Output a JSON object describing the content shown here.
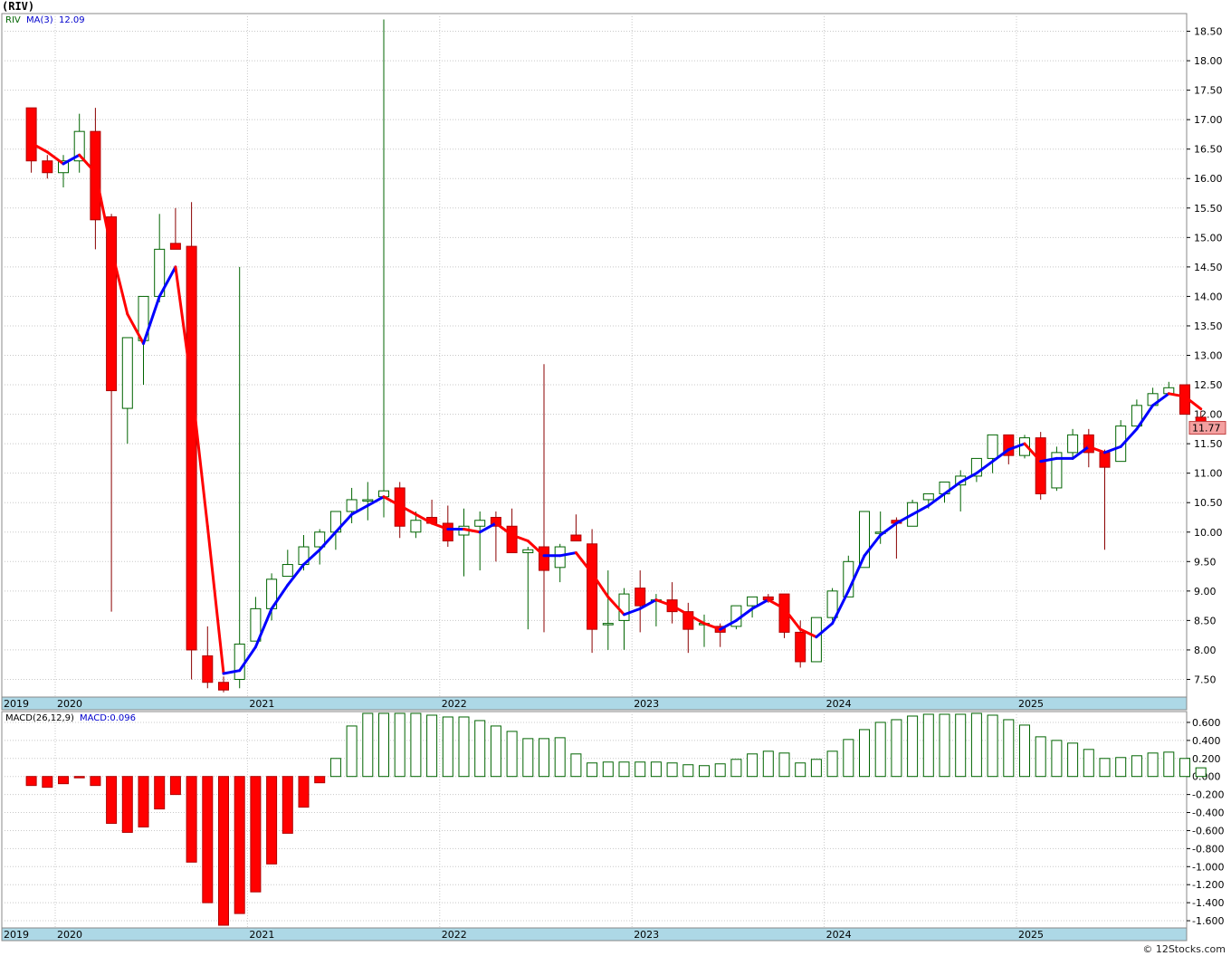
{
  "title": "(RIV)",
  "credit": "© 12Stocks.com",
  "price_panel": {
    "legend": {
      "symbol": "RIV",
      "ma_label": "MA(3)",
      "ma_value": "12.09"
    },
    "last_price": "11.77",
    "ylim": [
      7.2,
      18.8
    ],
    "y_ticks": [
      "7.50",
      "8.00",
      "8.50",
      "9.00",
      "9.50",
      "10.00",
      "10.50",
      "11.00",
      "11.50",
      "12.00",
      "12.50",
      "13.00",
      "13.50",
      "14.00",
      "14.50",
      "15.00",
      "15.50",
      "16.00",
      "16.50",
      "17.00",
      "17.50",
      "18.00",
      "18.50"
    ],
    "x_labels": [
      "2019",
      "2020",
      "2021",
      "2022",
      "2023",
      "2024",
      "2025"
    ]
  },
  "macd_panel": {
    "legend": {
      "label": "MACD(26,12,9)",
      "value": "MACD:0.096"
    },
    "ylim": [
      -1.68,
      0.72
    ],
    "y_ticks": [
      "-1.600",
      "-1.400",
      "-1.200",
      "-1.000",
      "-0.800",
      "-0.600",
      "-0.400",
      "-0.200",
      "0.000",
      "0.200",
      "0.400",
      "0.600"
    ],
    "x_labels": [
      "2019",
      "2020",
      "2021",
      "2022",
      "2023",
      "2024",
      "2025"
    ]
  },
  "colors": {
    "up": "#ffffff",
    "up_border": "#006400",
    "down": "#ff0000",
    "ma_up": "#0000ff",
    "ma_down": "#ff0000",
    "axis_band": "#add8e6",
    "grid": "#c8c8c8"
  },
  "chart_data": {
    "type": "candlestick",
    "interval": "monthly",
    "start": "2019-11",
    "series": [
      {
        "name": "price",
        "ohlc": [
          [
            17.2,
            17.2,
            16.1,
            16.3
          ],
          [
            16.3,
            16.4,
            16.0,
            16.1
          ],
          [
            16.1,
            16.4,
            15.85,
            16.3
          ],
          [
            16.3,
            17.1,
            16.1,
            16.8
          ],
          [
            16.8,
            17.2,
            14.8,
            15.3
          ],
          [
            15.35,
            15.4,
            8.65,
            12.4
          ],
          [
            12.1,
            13.3,
            11.5,
            13.3
          ],
          [
            13.25,
            14.0,
            12.5,
            14.0
          ],
          [
            14.0,
            15.4,
            13.9,
            14.8
          ],
          [
            14.9,
            15.5,
            14.8,
            14.8
          ],
          [
            14.85,
            15.6,
            7.5,
            8.0
          ],
          [
            7.9,
            8.4,
            7.35,
            7.45
          ],
          [
            7.45,
            7.55,
            7.28,
            7.32
          ],
          [
            7.5,
            14.5,
            7.35,
            8.1
          ],
          [
            8.15,
            8.9,
            8.15,
            8.7
          ],
          [
            8.7,
            9.3,
            8.5,
            9.2
          ],
          [
            9.25,
            9.7,
            9.25,
            9.45
          ],
          [
            9.45,
            9.95,
            9.35,
            9.75
          ],
          [
            9.75,
            10.05,
            9.45,
            10.0
          ],
          [
            10.0,
            10.35,
            9.7,
            10.35
          ],
          [
            10.35,
            10.75,
            10.15,
            10.55
          ],
          [
            10.55,
            10.85,
            10.2,
            10.55
          ],
          [
            10.6,
            18.7,
            10.25,
            10.7
          ],
          [
            10.75,
            10.85,
            9.9,
            10.1
          ],
          [
            10.0,
            10.35,
            9.9,
            10.2
          ],
          [
            10.25,
            10.55,
            10.15,
            10.15
          ],
          [
            10.15,
            10.45,
            9.75,
            9.85
          ],
          [
            9.95,
            10.4,
            9.25,
            10.1
          ],
          [
            10.1,
            10.35,
            9.35,
            10.2
          ],
          [
            10.25,
            10.35,
            9.5,
            10.1
          ],
          [
            10.1,
            10.4,
            9.65,
            9.65
          ],
          [
            9.65,
            9.75,
            8.35,
            9.7
          ],
          [
            9.75,
            12.85,
            8.3,
            9.35
          ],
          [
            9.4,
            9.8,
            9.15,
            9.75
          ],
          [
            9.95,
            10.3,
            9.85,
            9.85
          ],
          [
            9.8,
            10.05,
            7.95,
            8.35
          ],
          [
            8.45,
            9.35,
            8.0,
            8.45
          ],
          [
            8.5,
            9.05,
            8.0,
            8.95
          ],
          [
            9.05,
            9.35,
            8.3,
            8.75
          ],
          [
            8.85,
            8.95,
            8.4,
            8.85
          ],
          [
            8.85,
            9.15,
            8.45,
            8.65
          ],
          [
            8.65,
            8.8,
            7.95,
            8.35
          ],
          [
            8.45,
            8.6,
            8.05,
            8.45
          ],
          [
            8.4,
            8.45,
            8.05,
            8.3
          ],
          [
            8.4,
            8.7,
            8.35,
            8.75
          ],
          [
            8.75,
            8.9,
            8.55,
            8.9
          ],
          [
            8.9,
            8.95,
            8.8,
            8.85
          ],
          [
            8.95,
            8.95,
            8.2,
            8.3
          ],
          [
            8.3,
            8.5,
            7.7,
            7.8
          ],
          [
            7.8,
            8.55,
            7.8,
            8.55
          ],
          [
            8.55,
            9.05,
            8.5,
            9.0
          ],
          [
            8.9,
            9.6,
            8.9,
            9.5
          ],
          [
            9.4,
            10.35,
            9.4,
            10.35
          ],
          [
            10.0,
            10.35,
            9.8,
            10.0
          ],
          [
            10.2,
            10.25,
            9.55,
            10.15
          ],
          [
            10.1,
            10.55,
            10.1,
            10.5
          ],
          [
            10.55,
            10.6,
            10.4,
            10.65
          ],
          [
            10.65,
            10.75,
            10.5,
            10.85
          ],
          [
            10.8,
            11.05,
            10.35,
            10.95
          ],
          [
            10.95,
            11.15,
            10.85,
            11.25
          ],
          [
            11.25,
            11.65,
            11.0,
            11.65
          ],
          [
            11.65,
            11.65,
            11.15,
            11.3
          ],
          [
            11.3,
            11.65,
            11.25,
            11.6
          ],
          [
            11.6,
            11.7,
            10.55,
            10.65
          ],
          [
            10.75,
            11.45,
            10.7,
            11.35
          ],
          [
            11.35,
            11.75,
            11.25,
            11.65
          ],
          [
            11.65,
            11.75,
            11.1,
            11.35
          ],
          [
            11.35,
            11.4,
            9.7,
            11.1
          ],
          [
            11.2,
            11.9,
            11.2,
            11.8
          ],
          [
            11.8,
            12.25,
            11.8,
            12.15
          ],
          [
            12.15,
            12.45,
            12.15,
            12.35
          ],
          [
            12.35,
            12.55,
            12.35,
            12.45
          ],
          [
            12.5,
            12.5,
            12.0,
            12.0
          ],
          [
            11.95,
            12.05,
            11.75,
            11.77
          ]
        ]
      },
      {
        "name": "MA(3)",
        "values": [
          16.6,
          16.45,
          16.25,
          16.4,
          16.1,
          14.8,
          13.7,
          13.2,
          14.0,
          14.5,
          12.5,
          10.1,
          7.6,
          7.65,
          8.05,
          8.7,
          9.1,
          9.45,
          9.7,
          10.0,
          10.3,
          10.45,
          10.6,
          10.45,
          10.3,
          10.15,
          10.05,
          10.05,
          10.0,
          10.15,
          9.95,
          9.85,
          9.6,
          9.6,
          9.65,
          9.3,
          8.9,
          8.6,
          8.7,
          8.85,
          8.75,
          8.6,
          8.45,
          8.35,
          8.5,
          8.7,
          8.85,
          8.7,
          8.35,
          8.22,
          8.45,
          9.0,
          9.6,
          9.95,
          10.15,
          10.3,
          10.45,
          10.65,
          10.85,
          11.0,
          11.2,
          11.4,
          11.5,
          11.2,
          11.25,
          11.25,
          11.45,
          11.35,
          11.45,
          11.75,
          12.15,
          12.35,
          12.3,
          12.09
        ]
      },
      {
        "name": "MACD(26,12,9)",
        "values": [
          -0.1,
          -0.12,
          -0.08,
          -0.01,
          -0.1,
          -0.52,
          -0.62,
          -0.56,
          -0.36,
          -0.2,
          -0.95,
          -1.4,
          -1.65,
          -1.52,
          -1.28,
          -0.97,
          -0.63,
          -0.34,
          -0.07,
          0.2,
          0.56,
          0.7,
          0.7,
          0.7,
          0.7,
          0.68,
          0.66,
          0.66,
          0.62,
          0.56,
          0.5,
          0.42,
          0.42,
          0.43,
          0.25,
          0.15,
          0.16,
          0.16,
          0.16,
          0.16,
          0.15,
          0.13,
          0.12,
          0.14,
          0.19,
          0.25,
          0.28,
          0.26,
          0.15,
          0.19,
          0.28,
          0.41,
          0.52,
          0.6,
          0.63,
          0.67,
          0.69,
          0.69,
          0.69,
          0.7,
          0.68,
          0.63,
          0.57,
          0.44,
          0.4,
          0.37,
          0.3,
          0.2,
          0.21,
          0.23,
          0.26,
          0.27,
          0.2,
          0.096
        ]
      }
    ]
  }
}
